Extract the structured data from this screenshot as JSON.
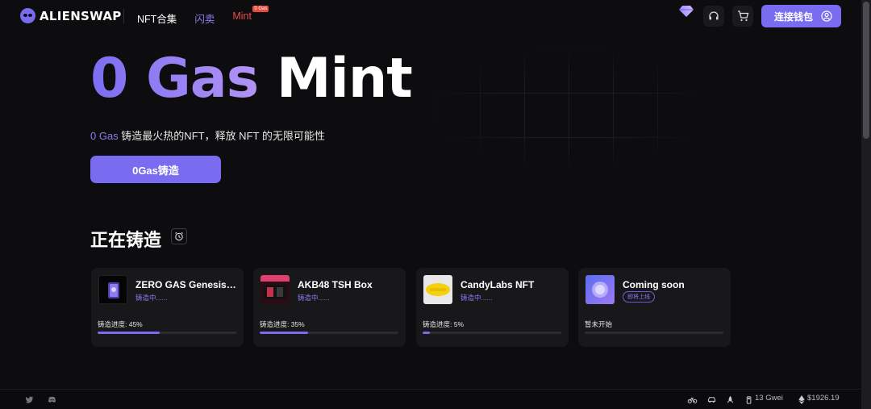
{
  "header": {
    "logo_text": "ALIENSWAP",
    "nav": {
      "collection": "NFT合集",
      "flash": "闪卖",
      "mint": "Mint",
      "mint_badge": "0 Gas"
    },
    "connect_wallet": "连接钱包"
  },
  "hero": {
    "title_grad": "0 Gas",
    "title_plain": "Mint",
    "sub_accent": "0 Gas",
    "sub_rest": " 铸造最火热的NFT，释放 NFT 的无限可能性",
    "cta": "0Gas铸造"
  },
  "section": {
    "title": "正在铸造"
  },
  "cards": [
    {
      "name": "ZERO GAS Genesis B...",
      "status": "铸造中......",
      "progress_label": "铸造进度: 45%",
      "progress": 45
    },
    {
      "name": "AKB48 TSH Box",
      "status": "铸造中......",
      "progress_label": "铸造进度: 35%",
      "progress": 35
    },
    {
      "name": "CandyLabs NFT",
      "status": "铸造中......",
      "progress_label": "铸造进度: 5%",
      "progress": 5
    },
    {
      "name": "Coming soon",
      "status": "即将上线",
      "progress_label": "暂未开始",
      "progress": 0
    }
  ],
  "footer": {
    "gas": "13 Gwei",
    "eth_price": "$1926.19"
  },
  "colors": {
    "accent": "#7a6cf0",
    "mint_red": "#e94b4b",
    "bg": "#0d0d0f"
  }
}
